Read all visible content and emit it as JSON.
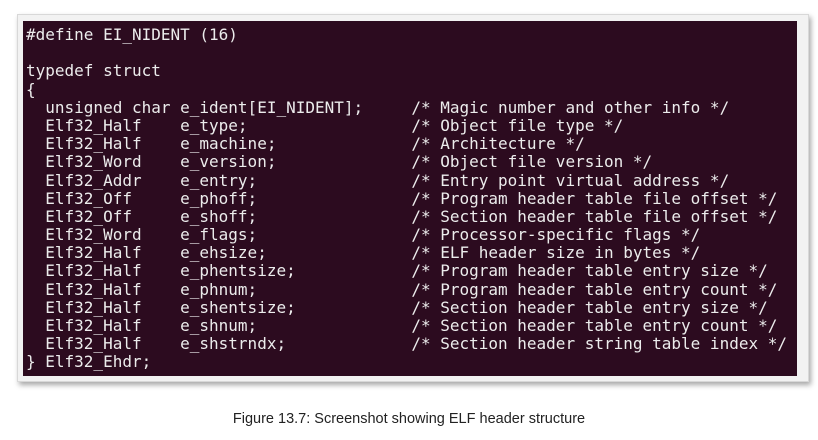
{
  "code": {
    "lines": [
      "#define EI_NIDENT (16)",
      "",
      "typedef struct",
      "{",
      "  unsigned char e_ident[EI_NIDENT];     /* Magic number and other info */",
      "  Elf32_Half    e_type;                 /* Object file type */",
      "  Elf32_Half    e_machine;              /* Architecture */",
      "  Elf32_Word    e_version;              /* Object file version */",
      "  Elf32_Addr    e_entry;                /* Entry point virtual address */",
      "  Elf32_Off     e_phoff;                /* Program header table file offset */",
      "  Elf32_Off     e_shoff;                /* Section header table file offset */",
      "  Elf32_Word    e_flags;                /* Processor-specific flags */",
      "  Elf32_Half    e_ehsize;               /* ELF header size in bytes */",
      "  Elf32_Half    e_phentsize;            /* Program header table entry size */",
      "  Elf32_Half    e_phnum;                /* Program header table entry count */",
      "  Elf32_Half    e_shentsize;            /* Section header table entry size */",
      "  Elf32_Half    e_shnum;                /* Section header table entry count */",
      "  Elf32_Half    e_shstrndx;             /* Section header string table index */",
      "} Elf32_Ehdr;"
    ]
  },
  "caption": "Figure 13.7: Screenshot showing ELF header structure"
}
